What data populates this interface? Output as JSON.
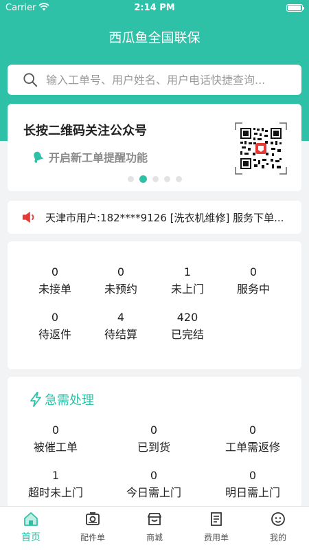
{
  "status_bar": {
    "carrier": "Carrier",
    "time": "2:14 PM"
  },
  "app": {
    "title": "西瓜鱼全国联保"
  },
  "search": {
    "placeholder": "输入工单号、用户姓名、用户电话快捷查询..."
  },
  "banner": {
    "title": "长按二维码关注公众号",
    "subtitle": "开启新工单提醒功能",
    "dots": 5,
    "active_dot": 1
  },
  "notice": {
    "text": "天津市用户:182****9126 [洗衣机维修] 服务下单..."
  },
  "stats": [
    {
      "value": "0",
      "label": "未接单"
    },
    {
      "value": "0",
      "label": "未预约"
    },
    {
      "value": "1",
      "label": "未上门"
    },
    {
      "value": "0",
      "label": "服务中"
    },
    {
      "value": "0",
      "label": "待返件"
    },
    {
      "value": "4",
      "label": "待结算"
    },
    {
      "value": "420",
      "label": "已完结"
    }
  ],
  "urgent": {
    "title": "急需处理",
    "items": [
      {
        "value": "0",
        "label": "被催工单"
      },
      {
        "value": "0",
        "label": "已到货"
      },
      {
        "value": "0",
        "label": "工单需返修"
      },
      {
        "value": "1",
        "label": "超时未上门"
      },
      {
        "value": "0",
        "label": "今日需上门"
      },
      {
        "value": "0",
        "label": "明日需上门"
      }
    ]
  },
  "tabs": [
    {
      "label": "首页",
      "icon": "home-icon",
      "active": true
    },
    {
      "label": "配件单",
      "icon": "parts-icon",
      "active": false
    },
    {
      "label": "商城",
      "icon": "store-icon",
      "active": false
    },
    {
      "label": "费用单",
      "icon": "bill-icon",
      "active": false
    },
    {
      "label": "我的",
      "icon": "profile-icon",
      "active": false
    }
  ],
  "colors": {
    "accent": "#2fc1a7",
    "background": "#f2f3f5",
    "speaker": "#e53935"
  }
}
